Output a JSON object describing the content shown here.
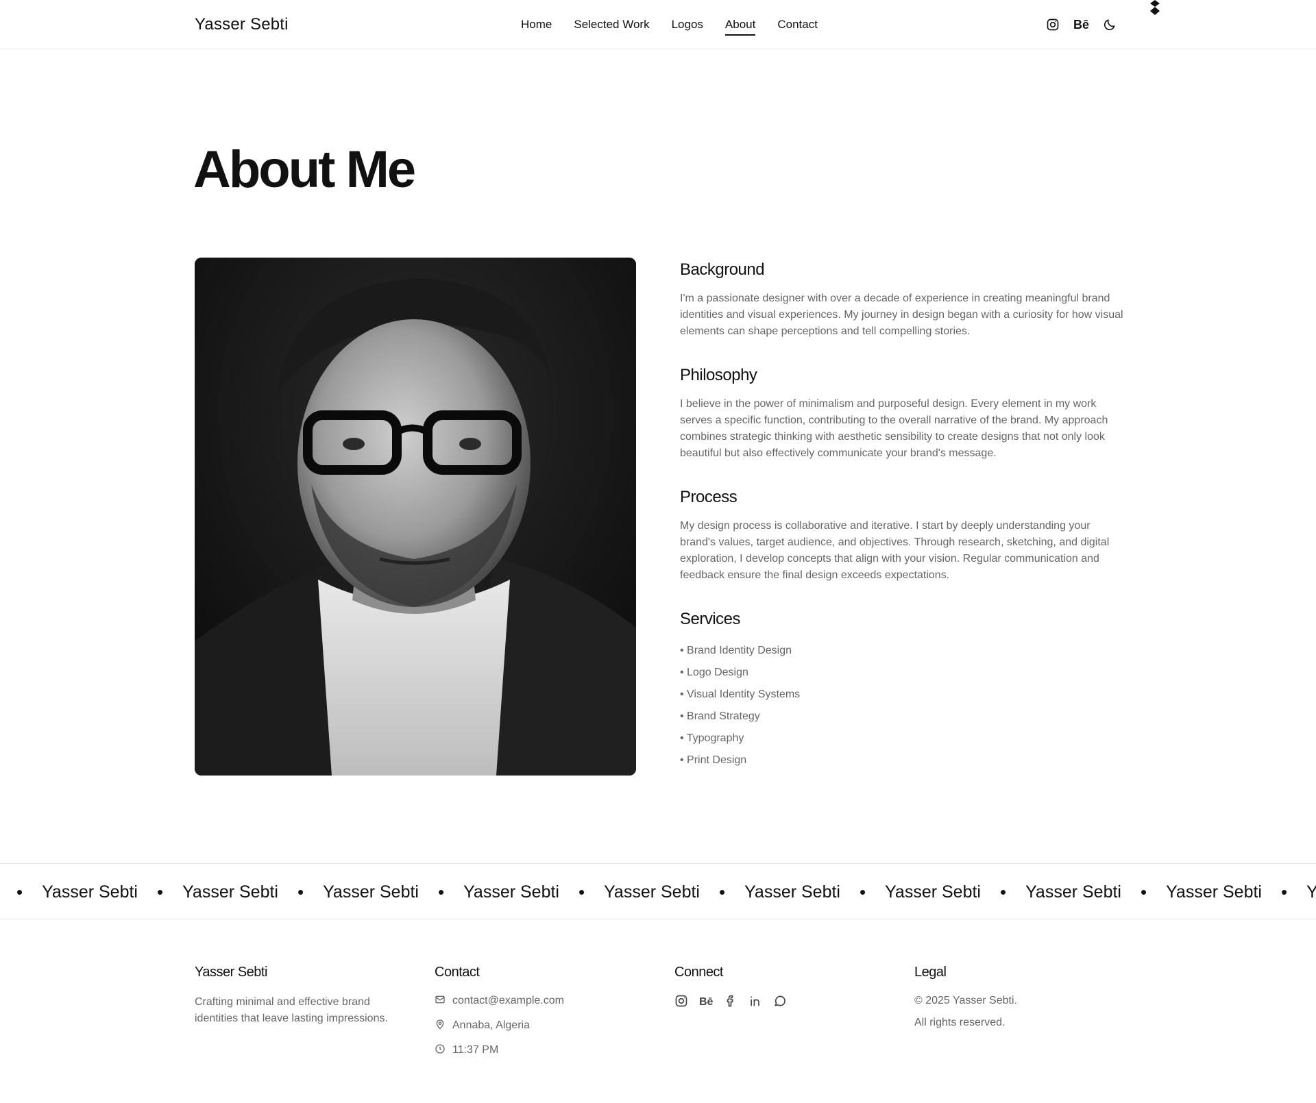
{
  "header": {
    "brand": "Yasser Sebti",
    "nav": [
      {
        "label": "Home",
        "active": false
      },
      {
        "label": "Selected Work",
        "active": false
      },
      {
        "label": "Logos",
        "active": false
      },
      {
        "label": "About",
        "active": true
      },
      {
        "label": "Contact",
        "active": false
      }
    ],
    "icons": [
      "instagram-icon",
      "behance-icon",
      "moon-icon"
    ],
    "behance_text": "Bē"
  },
  "page": {
    "title": "About Me"
  },
  "sections": {
    "background": {
      "heading": "Background",
      "text": "I'm a passionate designer with over a decade of experience in creating meaningful brand identities and visual experiences. My journey in design began with a curiosity for how visual elements can shape perceptions and tell compelling stories."
    },
    "philosophy": {
      "heading": "Philosophy",
      "text": "I believe in the power of minimalism and purposeful design. Every element in my work serves a specific function, contributing to the overall narrative of the brand. My approach combines strategic thinking with aesthetic sensibility to create designs that not only look beautiful but also effectively communicate your brand's message."
    },
    "process": {
      "heading": "Process",
      "text": "My design process is collaborative and iterative. I start by deeply understanding your brand's values, target audience, and objectives. Through research, sketching, and digital exploration, I develop concepts that align with your vision. Regular communication and feedback ensure the final design exceeds expectations."
    },
    "services": {
      "heading": "Services",
      "items": [
        "• Brand Identity Design",
        "• Logo Design",
        "• Visual Identity Systems",
        "• Brand Strategy",
        "• Typography",
        "• Print Design"
      ]
    }
  },
  "marquee": {
    "text": "Yasser Sebti",
    "separator": "•",
    "repeat": 10
  },
  "footer": {
    "brand": {
      "title": "Yasser Sebti",
      "description": "Crafting minimal and effective brand identities that leave lasting impressions."
    },
    "contact": {
      "title": "Contact",
      "email": "contact@example.com",
      "location": "Annaba, Algeria",
      "time": "11:37 PM"
    },
    "connect": {
      "title": "Connect",
      "behance_text": "Bē",
      "icons": [
        "instagram-icon",
        "behance-icon",
        "facebook-icon",
        "linkedin-icon",
        "chat-icon"
      ]
    },
    "legal": {
      "title": "Legal",
      "copyright": "© 2025 Yasser Sebti.",
      "rights": "All rights reserved."
    }
  }
}
